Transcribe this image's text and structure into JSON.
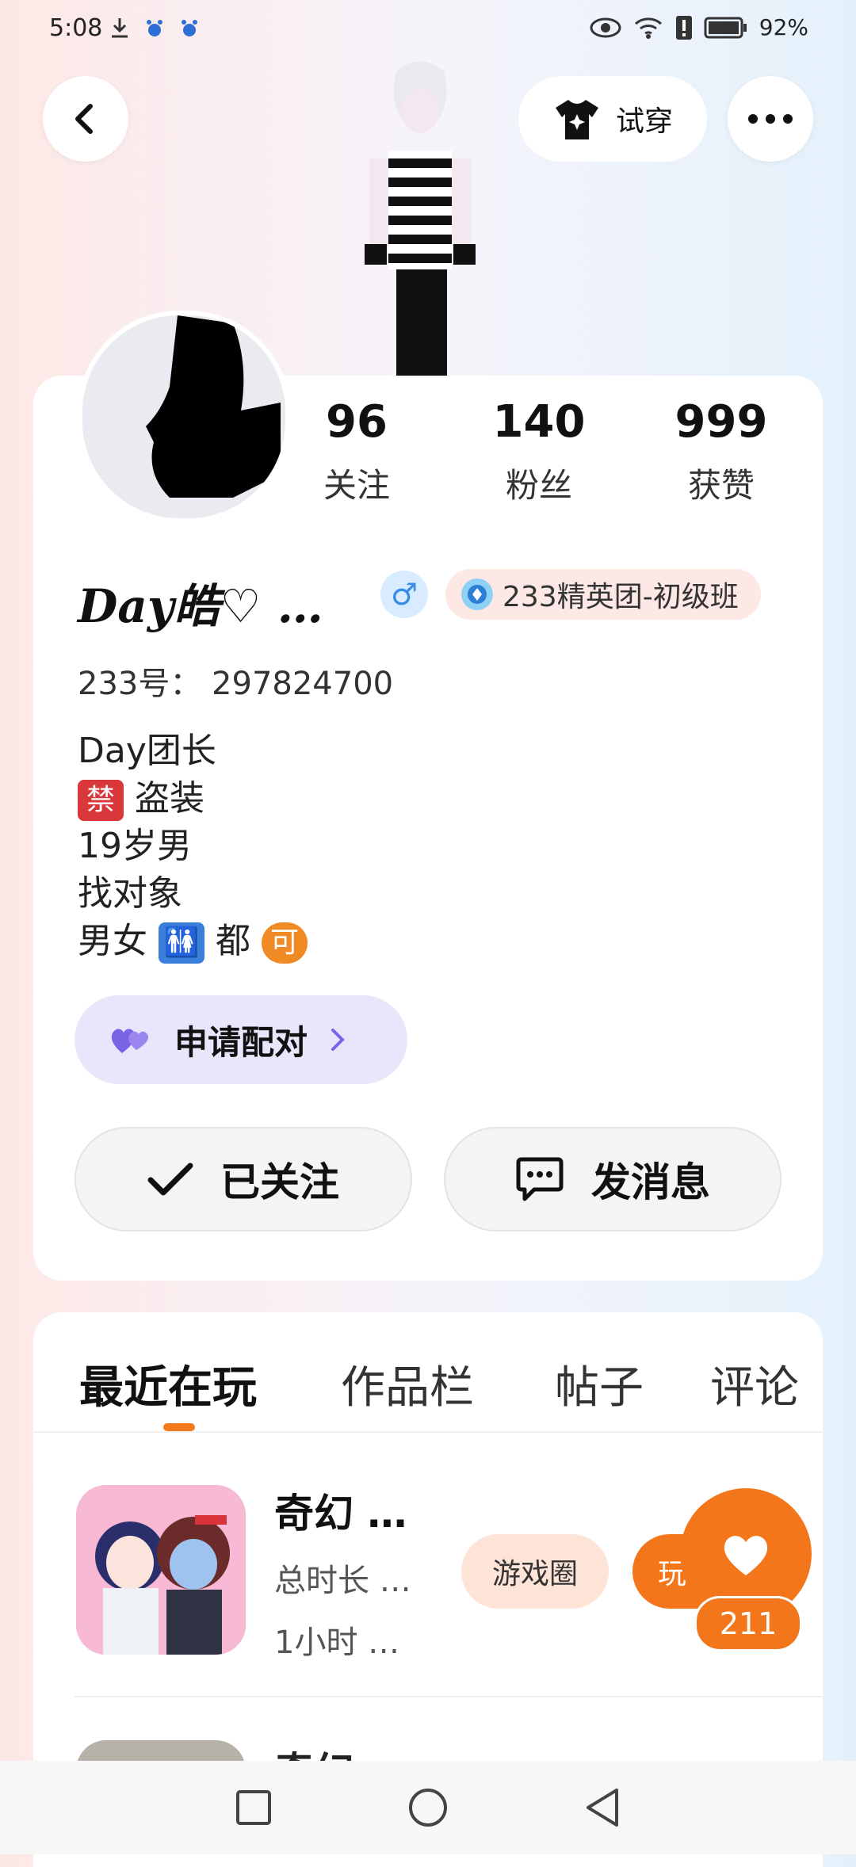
{
  "status_bar": {
    "time": "5:08",
    "battery": "92%"
  },
  "header": {
    "try_on_label": "试穿"
  },
  "profile": {
    "stats": [
      {
        "num": "96",
        "label": "关注"
      },
      {
        "num": "140",
        "label": "粉丝"
      },
      {
        "num": "999",
        "label": "获赞"
      }
    ],
    "username": "Day皓♡ …",
    "gender_symbol": "♂",
    "badge_label": "233精英团-初级班",
    "uid": "233号： 297824700",
    "bio": {
      "line1": "Day团长",
      "line2_icon": "禁",
      "line2_text": "盗装",
      "line3": "19岁男",
      "line4": "找对象",
      "line5_pre": "男女",
      "line5_icon": "🚻",
      "line5_mid": "都",
      "line5_icon2": "可"
    },
    "match_label": "申请配对",
    "follow_label": "已关注",
    "message_label": "发消息"
  },
  "tabs": [
    "最近在玩",
    "作品栏",
    "帖子",
    "评论"
  ],
  "game": {
    "title": "奇幻 …",
    "meta1": "总时长 …",
    "meta2": "1小时 …",
    "circle_label": "游戏圈",
    "play_label": "玩",
    "like_count": "211",
    "next_title": "奇幻"
  },
  "colors": {
    "accent": "#f4761b",
    "match_bg": "#e8e6fb",
    "badge_bg": "#fde8e6"
  }
}
